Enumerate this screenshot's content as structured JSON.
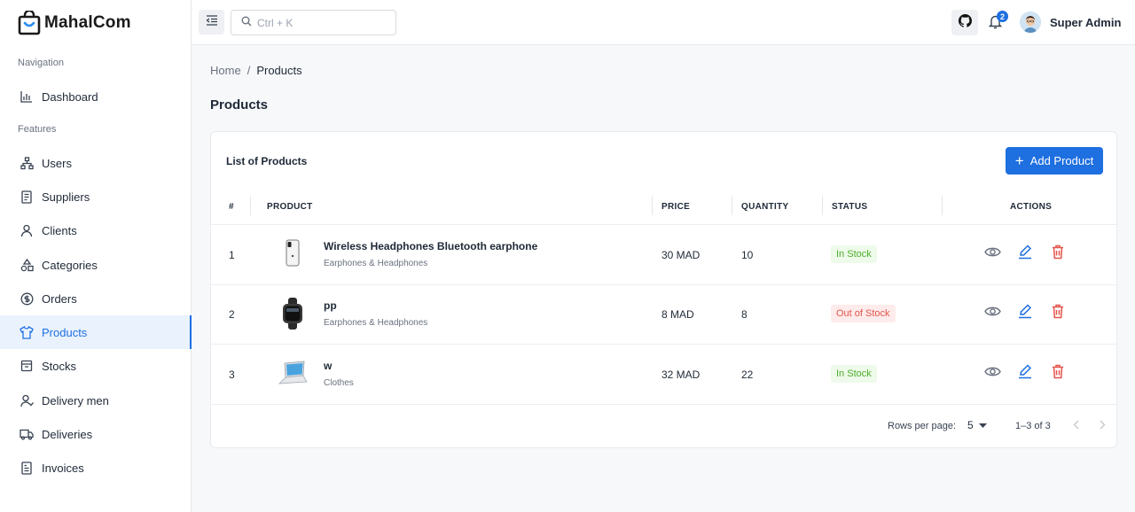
{
  "app": {
    "name": "MahalCom"
  },
  "sidebar": {
    "sections": [
      {
        "label": "Navigation"
      },
      {
        "label": "Features"
      }
    ],
    "items": [
      {
        "label": "Dashboard",
        "icon": "bar-chart-icon"
      },
      {
        "label": "Users",
        "icon": "users-hierarchy-icon"
      },
      {
        "label": "Suppliers",
        "icon": "receipt-icon"
      },
      {
        "label": "Clients",
        "icon": "user-icon"
      },
      {
        "label": "Categories",
        "icon": "categories-icon"
      },
      {
        "label": "Orders",
        "icon": "dollar-circle-icon"
      },
      {
        "label": "Products",
        "icon": "shirt-icon",
        "active": true
      },
      {
        "label": "Stocks",
        "icon": "stock-box-icon"
      },
      {
        "label": "Delivery men",
        "icon": "delivery-man-icon"
      },
      {
        "label": "Deliveries",
        "icon": "truck-icon"
      },
      {
        "label": "Invoices",
        "icon": "invoice-icon"
      }
    ]
  },
  "topbar": {
    "search_placeholder": "Ctrl + K",
    "notification_count": "2",
    "user_name": "Super Admin"
  },
  "breadcrumb": {
    "home": "Home",
    "separator": "/",
    "current": "Products"
  },
  "page": {
    "title": "Products"
  },
  "card": {
    "title": "List of Products",
    "add_button": "Add Product",
    "columns": [
      "#",
      "PRODUCT",
      "PRICE",
      "QUANTITY",
      "STATUS",
      "ACTIONS"
    ],
    "rows": [
      {
        "index": "1",
        "name": "Wireless Headphones Bluetooth earphone",
        "category": "Earphones & Headphones",
        "price": "30 MAD",
        "quantity": "10",
        "status": "In Stock",
        "status_type": "in",
        "image": "phone-image"
      },
      {
        "index": "2",
        "name": "pp",
        "category": "Earphones & Headphones",
        "price": "8 MAD",
        "quantity": "8",
        "status": "Out of Stock",
        "status_type": "out",
        "image": "smartwatch-image"
      },
      {
        "index": "3",
        "name": "w",
        "category": "Clothes",
        "price": "32 MAD",
        "quantity": "22",
        "status": "In Stock",
        "status_type": "in",
        "image": "laptop-image"
      }
    ],
    "pagination": {
      "rows_per_page_label": "Rows per page:",
      "rows_per_page_value": "5",
      "range": "1–3 of 3"
    }
  },
  "colors": {
    "accent": "#1e6fe0",
    "in_stock_text": "#4caf2a",
    "in_stock_bg": "#eefaea",
    "out_stock_text": "#e5534b",
    "out_stock_bg": "#fdeceb",
    "delete_icon": "#e5534b"
  }
}
